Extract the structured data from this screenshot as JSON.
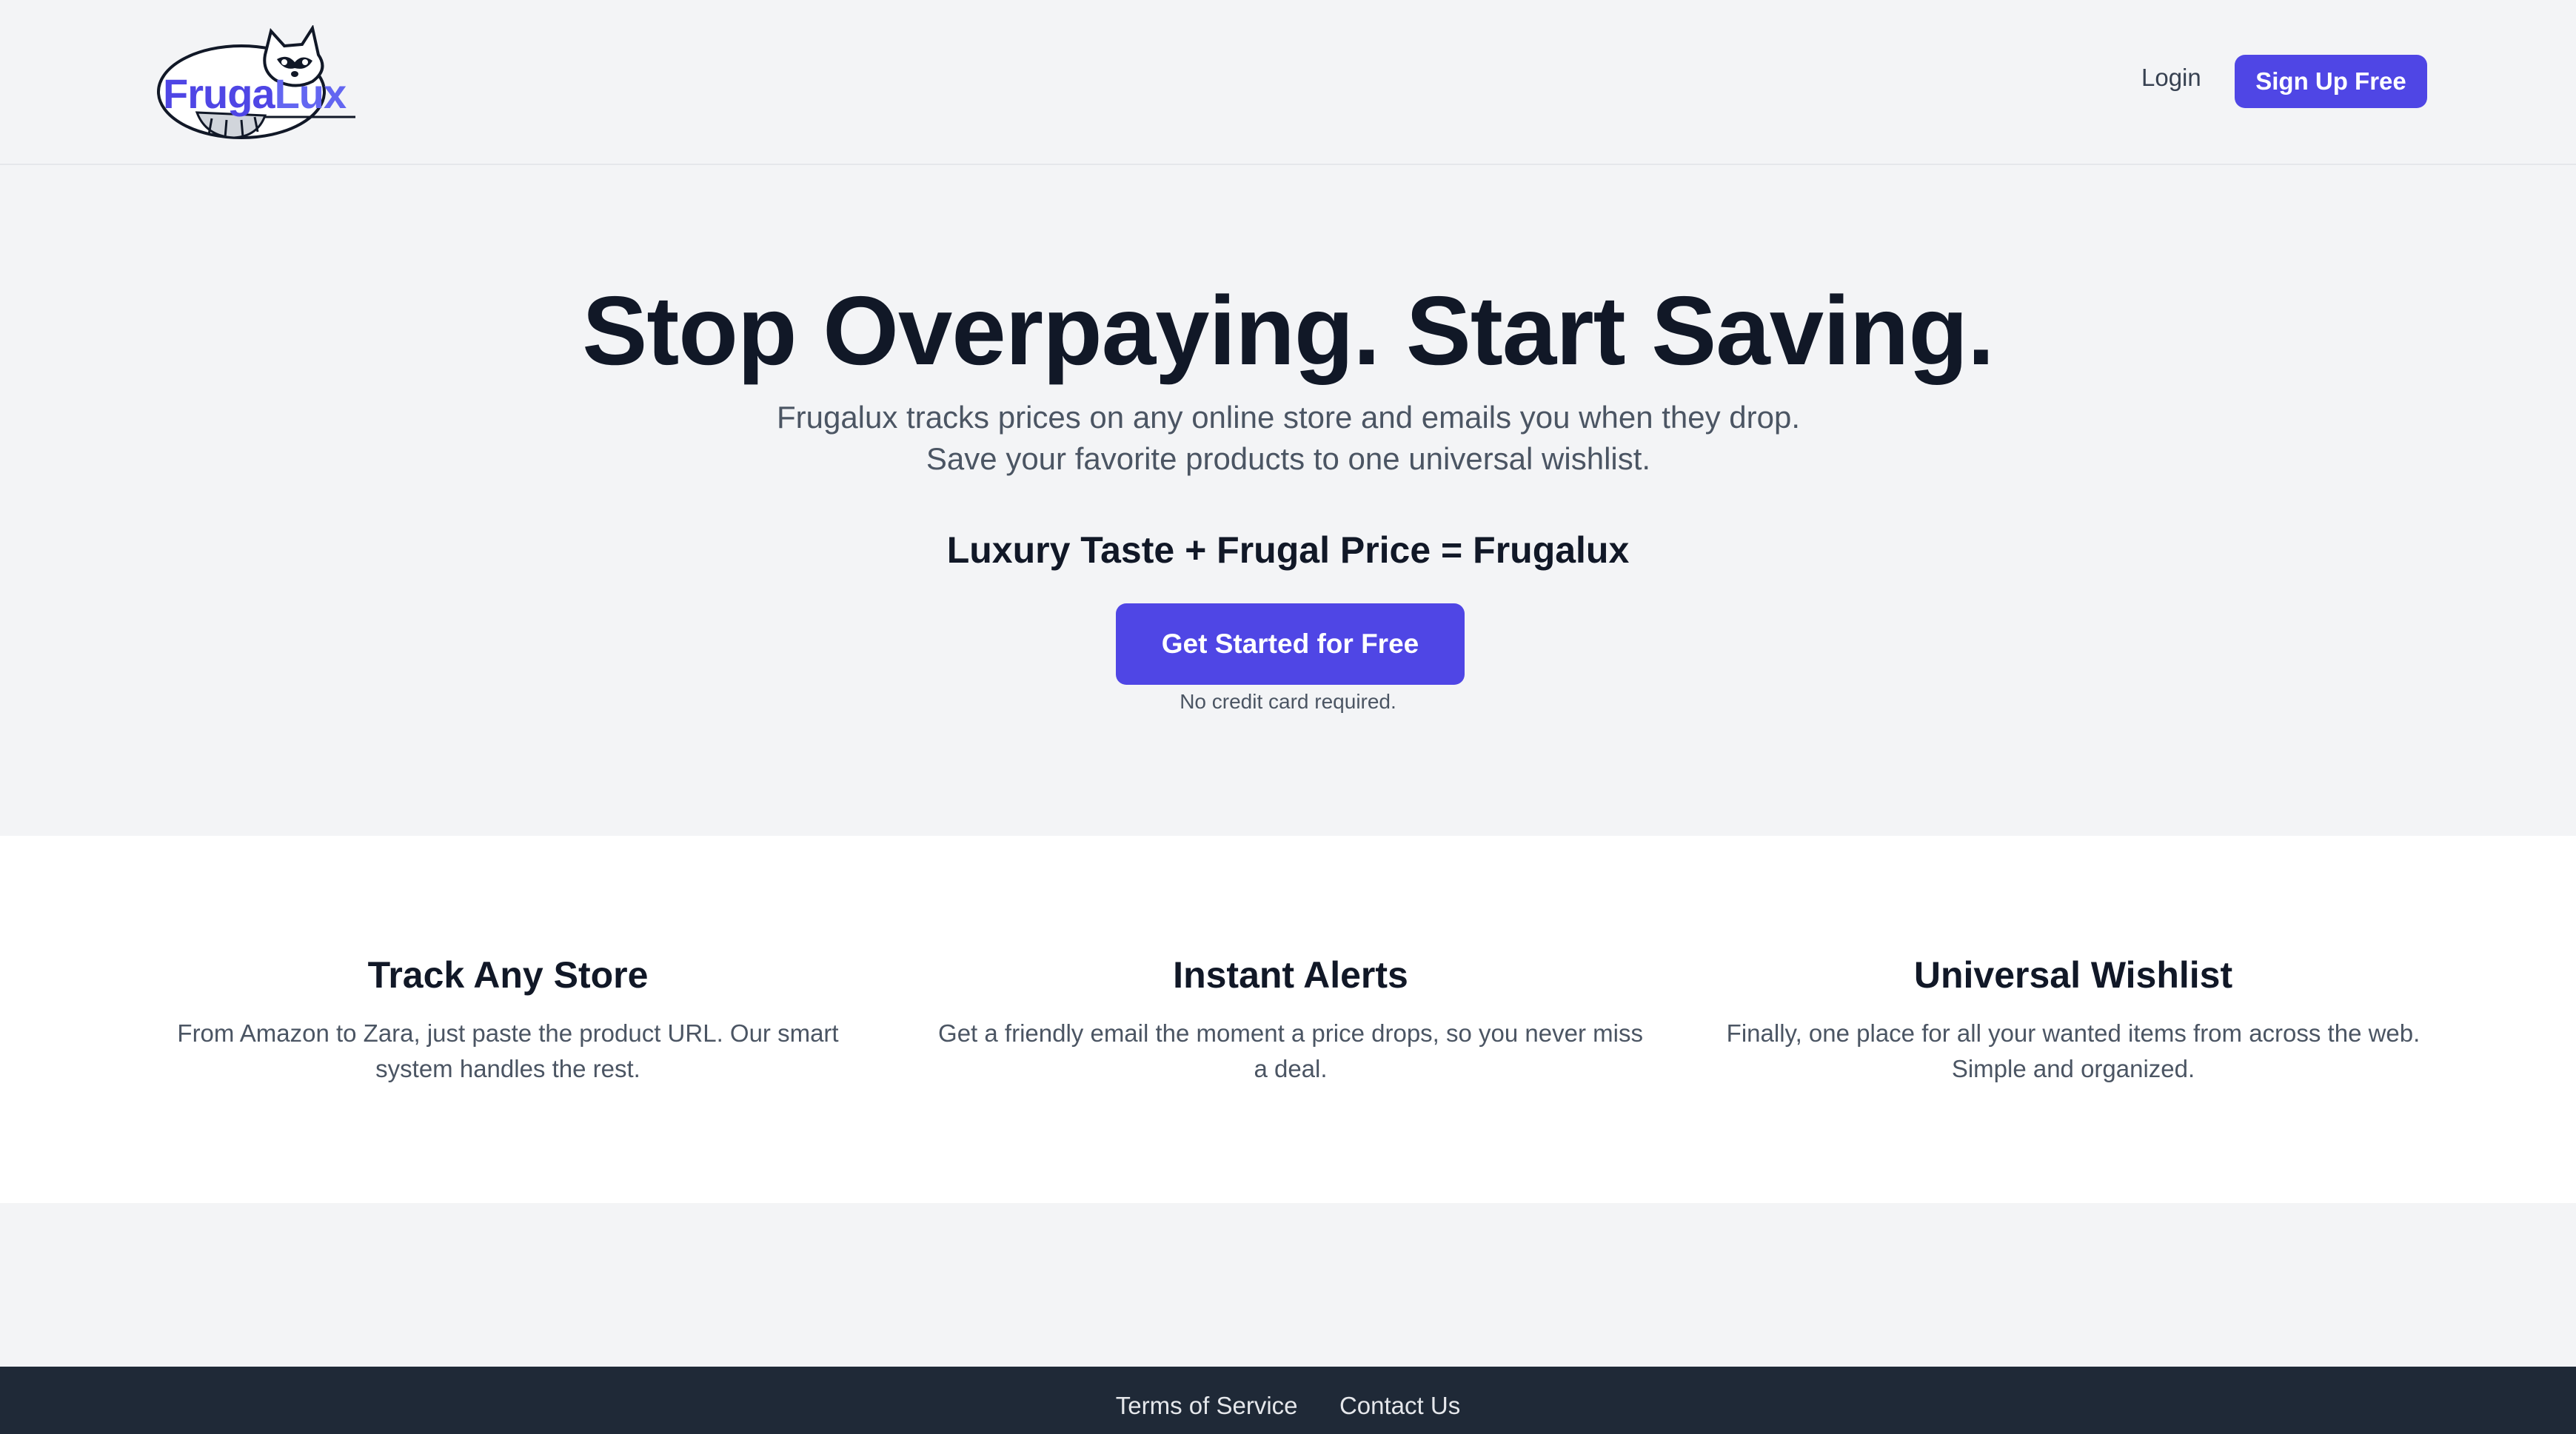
{
  "brand": {
    "logo_part1": "Fruga",
    "logo_part2": "Lux",
    "accent": "#4f46e5"
  },
  "nav": {
    "login": "Login",
    "signup": "Sign Up Free"
  },
  "hero": {
    "title": "Stop Overpaying. Start Saving.",
    "subtitle": "Frugalux tracks prices on any online store and emails you when they drop. Save your favorite products to one universal wishlist.",
    "equation": "Luxury Taste + Frugal Price = Frugalux",
    "cta": "Get Started for Free",
    "note": "No credit card required."
  },
  "features": [
    {
      "title": "Track Any Store",
      "text": "From Amazon to Zara, just paste the product URL. Our smart system handles the rest."
    },
    {
      "title": "Instant Alerts",
      "text": "Get a friendly email the moment a price drops, so you never miss a deal."
    },
    {
      "title": "Universal Wishlist",
      "text": "Finally, one place for all your wanted items from across the web. Simple and organized."
    }
  ],
  "footer": {
    "terms": "Terms of Service",
    "contact": "Contact Us"
  }
}
